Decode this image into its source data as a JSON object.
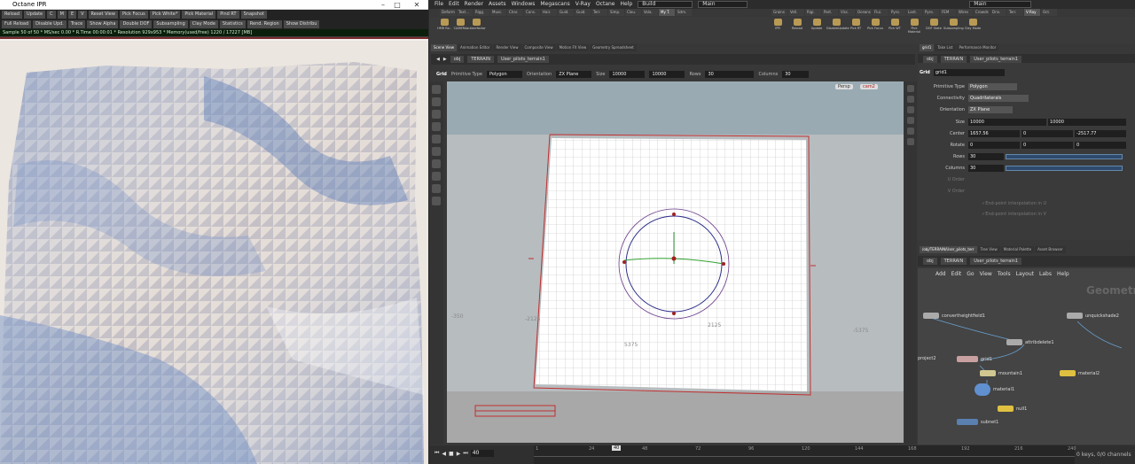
{
  "octane": {
    "title": "Octane IPR",
    "toolbar_row1": [
      "Reload",
      "Update",
      "C",
      "M",
      "E",
      "V",
      "Reset View",
      "Pick Focus",
      "Pick White*",
      "Pick Material",
      "Pind RT",
      "Snapshot"
    ],
    "toolbar_row2": [
      "Full Reload",
      "Disable Upd.",
      "Trace",
      "Show Alpha",
      "Double DOF",
      "Subsampling",
      "Clay Mode",
      "Statistics",
      "Rend. Region",
      "Show Distribu"
    ],
    "status": "Sample 50 of 50 * MS/sec 0.00 * R.Time 00:00:01 * Resolution 929x953 * Memory(used/free) 1220 / 17227 [MB]"
  },
  "houdini": {
    "menu": [
      "File",
      "Edit",
      "Render",
      "Assets",
      "Windows",
      "Megascans",
      "V-Ray",
      "Octane",
      "Help"
    ],
    "desktop_build": "Build",
    "desktop_main": "Main",
    "desktop_main2": "Main",
    "shelf_tabs_left": [
      "Deform",
      "Text...",
      "Rigg.",
      "Musc.",
      "Char.",
      "Cons.",
      "Hair.",
      "Guid.",
      "Guid.",
      "Terr.",
      "Simp.",
      "Clou.",
      "Vola.",
      "My T.",
      "Sdm."
    ],
    "shelf_tabs_right": [
      "Grains",
      "Vell.",
      "Rigi.",
      "Part.",
      "Visc.",
      "Oceans",
      "Flui.",
      "Pyro.",
      "Lant.",
      "Pyro.",
      "FEM",
      "Wires",
      "Crowds",
      "Driv.",
      "Terr.",
      "V-Ray",
      "Oct."
    ],
    "tools_left": [
      "HMR Ro..",
      "CAMERA",
      "autorefactor"
    ],
    "tools_right": [
      "IPR",
      "Reload",
      "Update",
      "DisableUpdate",
      "Pick RT",
      "Pick Focus",
      "Pick WT",
      "Pick Material",
      "DOF State",
      "Subsampling",
      "Clay Mode"
    ],
    "viewport_tabs": [
      "Scene View",
      "Animation Editor",
      "Render View",
      "Composite View",
      "Motion FX View",
      "Geometry Spreadsheet"
    ],
    "path_obj": "obj",
    "path_terrain": "TERRAIN",
    "path_node": "User_pilots_terrain1",
    "grid_label": "Grid",
    "primitive_type_label": "Primitive Type",
    "primitive_type": "Polygon",
    "orientation_label": "Orientation",
    "orientation": "ZX Plane",
    "size_label": "Size",
    "size_x": "10000",
    "size_y": "10000",
    "rows_label": "Rows",
    "rows": "30",
    "columns_label": "Columns",
    "columns": "30",
    "persp": "Persp",
    "cam": "cam2",
    "vp_numbers": [
      "-2125",
      "2125",
      "-5375",
      "5375",
      "-350"
    ],
    "params_tabs": [
      "grid1",
      "Take List",
      "Performance Monitor"
    ],
    "params_node_label": "Grid",
    "params_node_name": "grid1",
    "params": {
      "primitive_type_label": "Primitive Type",
      "primitive_type": "Polygon",
      "connectivity_label": "Connectivity",
      "connectivity": "Quadrilaterals",
      "orientation_label": "Orientation",
      "orientation": "ZX Plane",
      "size_label": "Size",
      "size_x": "10000",
      "size_y": "10000",
      "center_label": "Center",
      "center_x": "1657.56",
      "center_y": "0",
      "center_z": "-2517.77",
      "rotate_label": "Rotate",
      "rotate_x": "0",
      "rotate_y": "0",
      "rotate_z": "0",
      "rows_label": "Rows",
      "rows": "30",
      "columns_label": "Columns",
      "columns": "30",
      "uorder_label": "U Order",
      "vorder_label": "V Order",
      "endpoint_u": "End-point interpolation in U",
      "endpoint_v": "End-point interpolation in V"
    },
    "net_tabs": [
      "/obj/TERRAIN/User_pilots_terr",
      "Tree View",
      "Material Palette",
      "Asset Browser"
    ],
    "net_menu": [
      "Add",
      "Edit",
      "Go",
      "View",
      "Tools",
      "Layout",
      "Labs",
      "Help"
    ],
    "net_watermark": "Geometry",
    "nodes": [
      "convertheightfield1",
      "unquickshade2",
      "attribdelete1",
      "project2",
      "grid1",
      "mountain1",
      "material2",
      "material1",
      "null1",
      "subnet1"
    ],
    "timeline": {
      "frame": "40",
      "frame_field": "40",
      "ticks": [
        "1",
        "24",
        "48",
        "72",
        "96",
        "120",
        "144",
        "168",
        "192",
        "216",
        "240"
      ],
      "keys": "0 keys, 0/0 channels"
    }
  }
}
